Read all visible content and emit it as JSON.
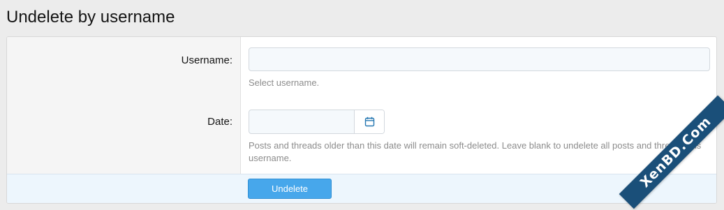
{
  "page": {
    "title": "Undelete by username"
  },
  "form": {
    "username": {
      "label": "Username:",
      "value": "",
      "placeholder": "",
      "explain": "Select username."
    },
    "date": {
      "label": "Date:",
      "value": "",
      "placeholder": "",
      "icon": "calendar-icon",
      "explain": "Posts and threads older than this date will remain soft-deleted. Leave blank to undelete all posts and threads this username."
    },
    "submit_label": "Undelete"
  },
  "watermark": {
    "text": "XenBD.Com"
  },
  "colors": {
    "accent": "#47a7eb",
    "submit_row_bg": "#edf6fd",
    "watermark_bg": "#1a4f79"
  }
}
